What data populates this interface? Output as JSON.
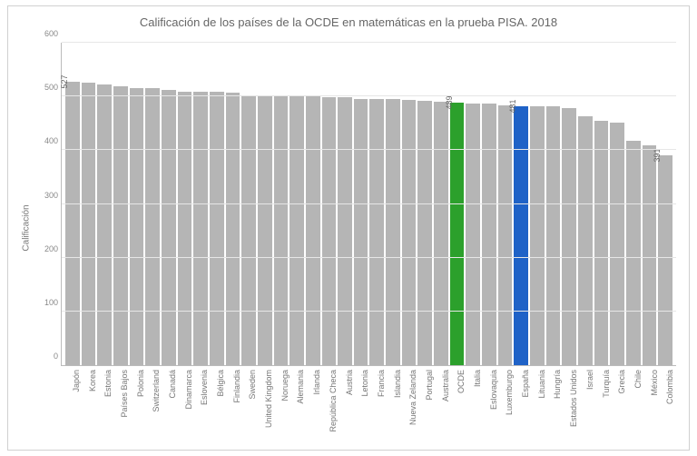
{
  "chart_data": {
    "type": "bar",
    "title": "Calificación de los países de la OCDE en matemáticas en la prueba PISA. 2018",
    "ylabel": "Calificación",
    "ylim": [
      0,
      600
    ],
    "yticks": [
      0,
      100,
      200,
      300,
      400,
      500,
      600
    ],
    "categories": [
      "Japón",
      "Korea",
      "Estonia",
      "Países Bajos",
      "Polonia",
      "Switzerland",
      "Canadá",
      "Dinamarca",
      "Eslovenia",
      "Bélgica",
      "Finlandia",
      "Sweden",
      "United Kingdom",
      "Noruega",
      "Alemania",
      "Irlanda",
      "República Checa",
      "Austria",
      "Letonia",
      "Francia",
      "Islandia",
      "Nueva Zelanda",
      "Portugal",
      "Australia",
      "OCDE",
      "Italia",
      "Eslovaquia",
      "Luxemburgo",
      "España",
      "Lituania",
      "Hungría",
      "Estados Unidos",
      "Israel",
      "Turquía",
      "Grecia",
      "Chile",
      "México",
      "Colombia"
    ],
    "values": [
      527,
      526,
      523,
      519,
      516,
      515,
      512,
      509,
      509,
      508,
      507,
      502,
      502,
      501,
      500,
      500,
      499,
      499,
      496,
      495,
      495,
      494,
      492,
      491,
      489,
      487,
      486,
      483,
      481,
      481,
      481,
      478,
      463,
      454,
      451,
      417,
      409,
      391
    ],
    "highlights": {
      "OCDE": {
        "color": "green",
        "show_value": true,
        "value": 489
      },
      "España": {
        "color": "blue",
        "show_value": true,
        "value": 481
      },
      "Japón": {
        "show_value": true,
        "value": 527
      },
      "Colombia": {
        "show_value": true,
        "value": 391
      }
    }
  }
}
